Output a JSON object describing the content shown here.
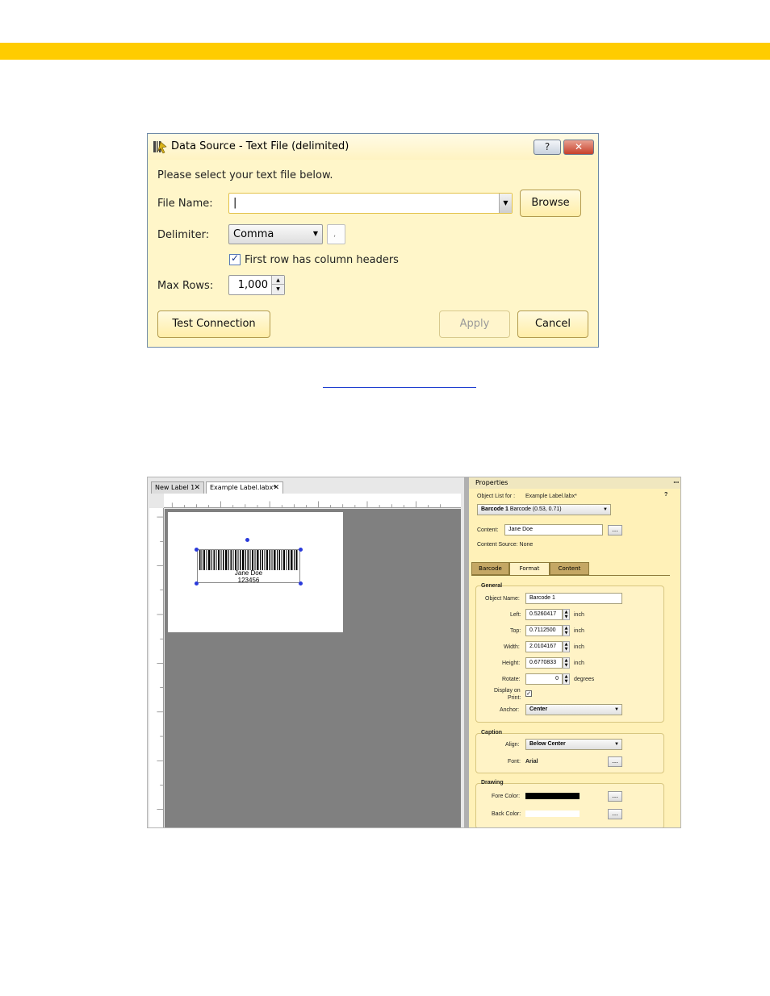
{
  "dialog": {
    "title": "Data Source - Text File (delimited)",
    "help_label": "?",
    "close_label": "✕",
    "instruction": "Please select your text file below.",
    "file_name_label": "File Name:",
    "file_name_value": "|",
    "browse_label": "Browse",
    "delimiter_label": "Delimiter:",
    "delimiter_value": "Comma",
    "delimiter_char": ",",
    "first_row_label": "First row has column headers",
    "first_row_checked": true,
    "max_rows_label": "Max Rows:",
    "max_rows_value": "1,000",
    "test_connection_label": "Test Connection",
    "apply_label": "Apply",
    "cancel_label": "Cancel"
  },
  "app": {
    "tabs": [
      {
        "label": "New Label 1",
        "close": "✕"
      },
      {
        "label": "Example Label.labx*",
        "close": "✕"
      }
    ],
    "barcode_caption_line1": "Jane Doe",
    "barcode_caption_line2": "123456",
    "properties": {
      "header": "Properties",
      "pin": "ꟷ",
      "help": "?",
      "object_list_label": "Object List for :",
      "object_list_file": "Example Label.labx*",
      "object_select": "Barcode 1",
      "object_select_detail": "Barcode (0.53, 0.71)",
      "content_label": "Content:",
      "content_value": "Jane Doe",
      "content_source": "Content Source: None",
      "tabs": [
        "Barcode",
        "Format",
        "Content"
      ],
      "general": {
        "title": "General",
        "object_name_label": "Object Name:",
        "object_name_value": "Barcode 1",
        "left_label": "Left:",
        "left_value": "0.5260417",
        "top_label": "Top:",
        "top_value": "0.7112500",
        "width_label": "Width:",
        "width_value": "2.0104167",
        "height_label": "Height:",
        "height_value": "0.6770833",
        "rotate_label": "Rotate:",
        "rotate_value": "0",
        "unit": "inch",
        "degrees": "degrees",
        "display_on_print_label1": "Display on",
        "display_on_print_label2": "Print:",
        "anchor_label": "Anchor:",
        "anchor_value": "Center"
      },
      "caption": {
        "title": "Caption",
        "align_label": "Align:",
        "align_value": "Below Center",
        "font_label": "Font:",
        "font_value": "Arial"
      },
      "drawing": {
        "title": "Drawing",
        "fore_color_label": "Fore Color:",
        "back_color_label": "Back Color:"
      },
      "ellipsis": "..."
    }
  },
  "colors": {
    "accent_bar": "#ffcc00",
    "dialog_bg": "#fff6c9",
    "props_bg": "#fff1b8",
    "hyperlink": "#1f3fd0"
  }
}
